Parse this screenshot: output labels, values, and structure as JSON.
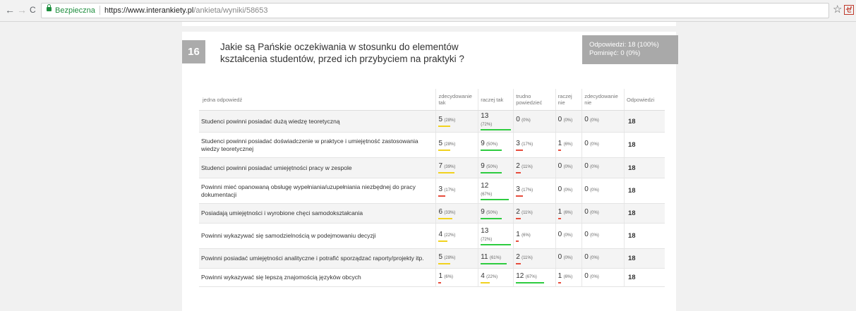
{
  "browser": {
    "back_icon": "←",
    "forward_icon": "→",
    "reload_icon": "C",
    "secure_label": "Bezpieczna",
    "url_host": "https://www.interankiety.pl",
    "url_path": "/ankieta/wyniki/58653",
    "star_icon": "☆",
    "ext_icon": "ゼ"
  },
  "question": {
    "number": "16",
    "title": "Jakie są Pańskie oczekiwania w stosunku do elementów kształcenia studentów, przed ich przybyciem na praktyki ?",
    "answers_label": "Odpowiedzi: 18 (100%)",
    "skipped_label": "Pominięć: 0 (0%)"
  },
  "table": {
    "headers": [
      "jedna odpowiedź",
      "zdecydowanie tak",
      "raczej tak",
      "trudno powiedzieć",
      "raczej nie",
      "zdecydowanie nie",
      "Odpowiedzi"
    ],
    "colors": {
      "zdecydowanie tak": "#f1d21f",
      "raczej tak": "#2ecc40",
      "trudno powiedzieć": "#e74c3c",
      "raczej nie": "#e74c3c",
      "zdecydowanie nie": "#e74c3c"
    },
    "rows": [
      {
        "label": "Studenci powinni posiadać dużą wiedzę teoretyczną",
        "cells": [
          {
            "n": "5",
            "p": "(28%)",
            "v": 28,
            "c": "#f1d21f"
          },
          {
            "n": "13",
            "p": "(72%)",
            "v": 72,
            "c": "#2ecc40"
          },
          {
            "n": "0",
            "p": "(0%)",
            "v": 0,
            "c": "#e74c3c"
          },
          {
            "n": "0",
            "p": "(0%)",
            "v": 0,
            "c": "#e74c3c"
          },
          {
            "n": "0",
            "p": "(0%)",
            "v": 0,
            "c": "#e74c3c"
          }
        ],
        "total": "18"
      },
      {
        "label": "Studenci powinni posiadać doświadczenie w praktyce i umiejętność zastosowania wiedzy teoretycznej",
        "cells": [
          {
            "n": "5",
            "p": "(28%)",
            "v": 28,
            "c": "#f1d21f"
          },
          {
            "n": "9",
            "p": "(50%)",
            "v": 50,
            "c": "#2ecc40"
          },
          {
            "n": "3",
            "p": "(17%)",
            "v": 17,
            "c": "#e74c3c"
          },
          {
            "n": "1",
            "p": "(6%)",
            "v": 6,
            "c": "#e74c3c"
          },
          {
            "n": "0",
            "p": "(0%)",
            "v": 0,
            "c": "#e74c3c"
          }
        ],
        "total": "18"
      },
      {
        "label": "Studenci powinni posiadać umiejętności pracy w zespole",
        "cells": [
          {
            "n": "7",
            "p": "(39%)",
            "v": 39,
            "c": "#f1d21f"
          },
          {
            "n": "9",
            "p": "(50%)",
            "v": 50,
            "c": "#2ecc40"
          },
          {
            "n": "2",
            "p": "(11%)",
            "v": 11,
            "c": "#e74c3c"
          },
          {
            "n": "0",
            "p": "(0%)",
            "v": 0,
            "c": "#e74c3c"
          },
          {
            "n": "0",
            "p": "(0%)",
            "v": 0,
            "c": "#e74c3c"
          }
        ],
        "total": "18"
      },
      {
        "label": "Powinni mieć opanowaną obsługę wypełniania/uzupełniania niezbędnej do pracy dokumentacji",
        "cells": [
          {
            "n": "3",
            "p": "(17%)",
            "v": 17,
            "c": "#e74c3c"
          },
          {
            "n": "12",
            "p": "(67%)",
            "v": 67,
            "c": "#2ecc40"
          },
          {
            "n": "3",
            "p": "(17%)",
            "v": 17,
            "c": "#e74c3c"
          },
          {
            "n": "0",
            "p": "(0%)",
            "v": 0,
            "c": "#e74c3c"
          },
          {
            "n": "0",
            "p": "(0%)",
            "v": 0,
            "c": "#e74c3c"
          }
        ],
        "total": "18"
      },
      {
        "label": "Posiadają umiejętności i wyrobione chęci samodokształcania",
        "cells": [
          {
            "n": "6",
            "p": "(33%)",
            "v": 33,
            "c": "#f1d21f"
          },
          {
            "n": "9",
            "p": "(50%)",
            "v": 50,
            "c": "#2ecc40"
          },
          {
            "n": "2",
            "p": "(11%)",
            "v": 11,
            "c": "#e74c3c"
          },
          {
            "n": "1",
            "p": "(6%)",
            "v": 6,
            "c": "#e74c3c"
          },
          {
            "n": "0",
            "p": "(0%)",
            "v": 0,
            "c": "#e74c3c"
          }
        ],
        "total": "18"
      },
      {
        "label": "Powinni wykazywać się samodzielnością w podejmowaniu decyzji",
        "cells": [
          {
            "n": "4",
            "p": "(22%)",
            "v": 22,
            "c": "#f1d21f"
          },
          {
            "n": "13",
            "p": "(72%)",
            "v": 72,
            "c": "#2ecc40"
          },
          {
            "n": "1",
            "p": "(6%)",
            "v": 6,
            "c": "#e74c3c"
          },
          {
            "n": "0",
            "p": "(0%)",
            "v": 0,
            "c": "#e74c3c"
          },
          {
            "n": "0",
            "p": "(0%)",
            "v": 0,
            "c": "#e74c3c"
          }
        ],
        "total": "18"
      },
      {
        "label": "Powinni posiadać umiejętności analityczne i potrafić sporządzać raporty/projekty itp.",
        "cells": [
          {
            "n": "5",
            "p": "(28%)",
            "v": 28,
            "c": "#f1d21f"
          },
          {
            "n": "11",
            "p": "(61%)",
            "v": 61,
            "c": "#2ecc40"
          },
          {
            "n": "2",
            "p": "(11%)",
            "v": 11,
            "c": "#e74c3c"
          },
          {
            "n": "0",
            "p": "(0%)",
            "v": 0,
            "c": "#e74c3c"
          },
          {
            "n": "0",
            "p": "(0%)",
            "v": 0,
            "c": "#e74c3c"
          }
        ],
        "total": "18"
      },
      {
        "label": "Powinni wykazywać się lepszą znajomością języków obcych",
        "cells": [
          {
            "n": "1",
            "p": "(6%)",
            "v": 6,
            "c": "#e74c3c"
          },
          {
            "n": "4",
            "p": "(22%)",
            "v": 22,
            "c": "#f1d21f"
          },
          {
            "n": "12",
            "p": "(67%)",
            "v": 67,
            "c": "#2ecc40"
          },
          {
            "n": "1",
            "p": "(6%)",
            "v": 6,
            "c": "#e74c3c"
          },
          {
            "n": "0",
            "p": "(0%)",
            "v": 0,
            "c": "#e74c3c"
          }
        ],
        "total": "18"
      }
    ]
  }
}
